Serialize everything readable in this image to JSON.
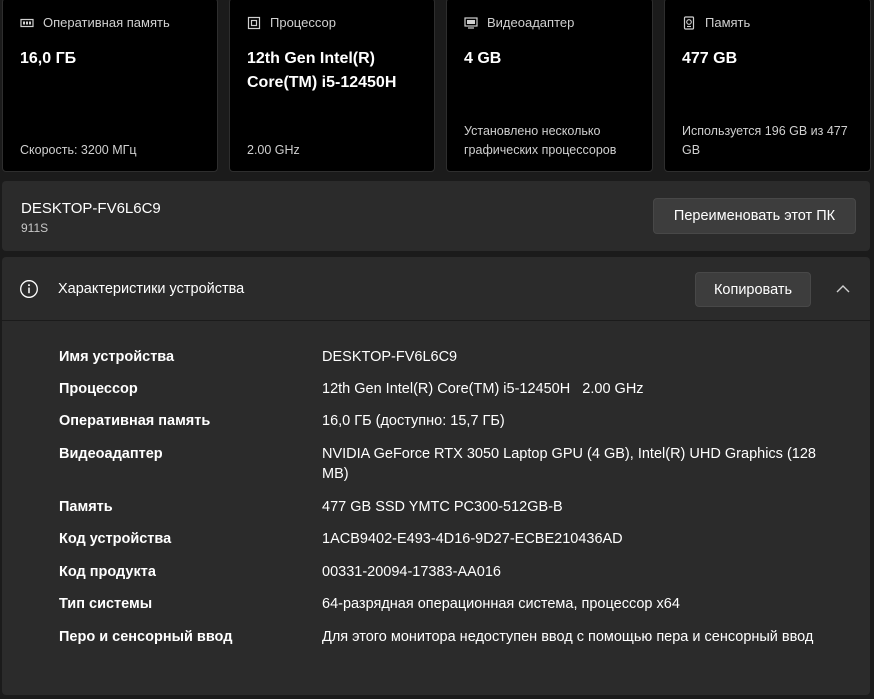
{
  "cards": [
    {
      "title": "Оперативная память",
      "icon": "memory-chip-icon",
      "value": "16,0 ГБ",
      "sub": "Скорость: 3200 МГц"
    },
    {
      "title": "Процессор",
      "icon": "processor-icon",
      "value": "12th Gen Intel(R) Core(TM) i5-12450H",
      "sub": "2.00 GHz"
    },
    {
      "title": "Видеоадаптер",
      "icon": "display-adapter-icon",
      "value": "4 GB",
      "sub": "Установлено несколько графических процессоров"
    },
    {
      "title": "Память",
      "icon": "storage-drive-icon",
      "value": "477 GB",
      "sub": "Используется 196 GB из 477 GB"
    }
  ],
  "pc": {
    "name": "DESKTOP-FV6L6C9",
    "model": "911S",
    "rename_label": "Переименовать этот ПК"
  },
  "specs": {
    "title": "Характеристики устройства",
    "copy_label": "Копировать",
    "icon": "info-icon",
    "rows": [
      {
        "key": "Имя устройства",
        "value": "DESKTOP-FV6L6C9"
      },
      {
        "key": "Процессор",
        "value": "12th Gen Intel(R) Core(TM) i5-12450H   2.00 GHz"
      },
      {
        "key": "Оперативная память",
        "value": "16,0 ГБ (доступно: 15,7 ГБ)"
      },
      {
        "key": "Видеоадаптер",
        "value": "NVIDIA GeForce RTX 3050 Laptop GPU (4 GB), Intel(R) UHD Graphics (128 MB)"
      },
      {
        "key": "Память",
        "value": "477 GB SSD YMTC PC300-512GB-B"
      },
      {
        "key": "Код устройства",
        "value": "1ACB9402-E493-4D16-9D27-ECBE210436AD"
      },
      {
        "key": "Код продукта",
        "value": "00331-20094-17383-AA016"
      },
      {
        "key": "Тип системы",
        "value": "64-разрядная операционная система, процессор x64"
      },
      {
        "key": "Перо и сенсорный ввод",
        "value": "Для этого монитора недоступен ввод с помощью пера и сенсорный ввод"
      }
    ]
  }
}
